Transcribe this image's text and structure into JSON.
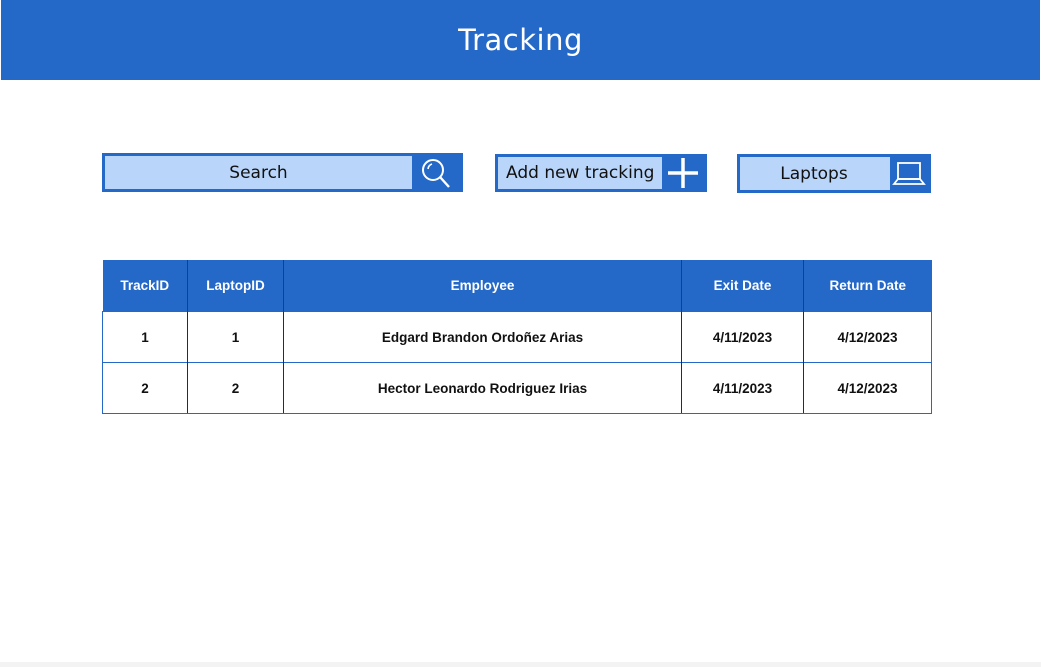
{
  "page": {
    "title": "Tracking"
  },
  "toolbar": {
    "search_label": "Search",
    "add_label": "Add new tracking",
    "laptops_label": "Laptops"
  },
  "colors": {
    "primary": "#2468c8",
    "control_fill": "#b9d5f9"
  },
  "icons": {
    "search": "magnifier-icon",
    "add": "plus-icon",
    "laptops": "laptop-icon"
  },
  "table": {
    "columns": [
      "TrackID",
      "LaptopID",
      "Employee",
      "Exit Date",
      "Return Date"
    ],
    "rows": [
      [
        "1",
        "1",
        "Edgard Brandon Ordoñez Arias",
        "4/11/2023",
        "4/12/2023"
      ],
      [
        "2",
        "2",
        "Hector Leonardo Rodriguez Irias",
        "4/11/2023",
        "4/12/2023"
      ]
    ]
  }
}
